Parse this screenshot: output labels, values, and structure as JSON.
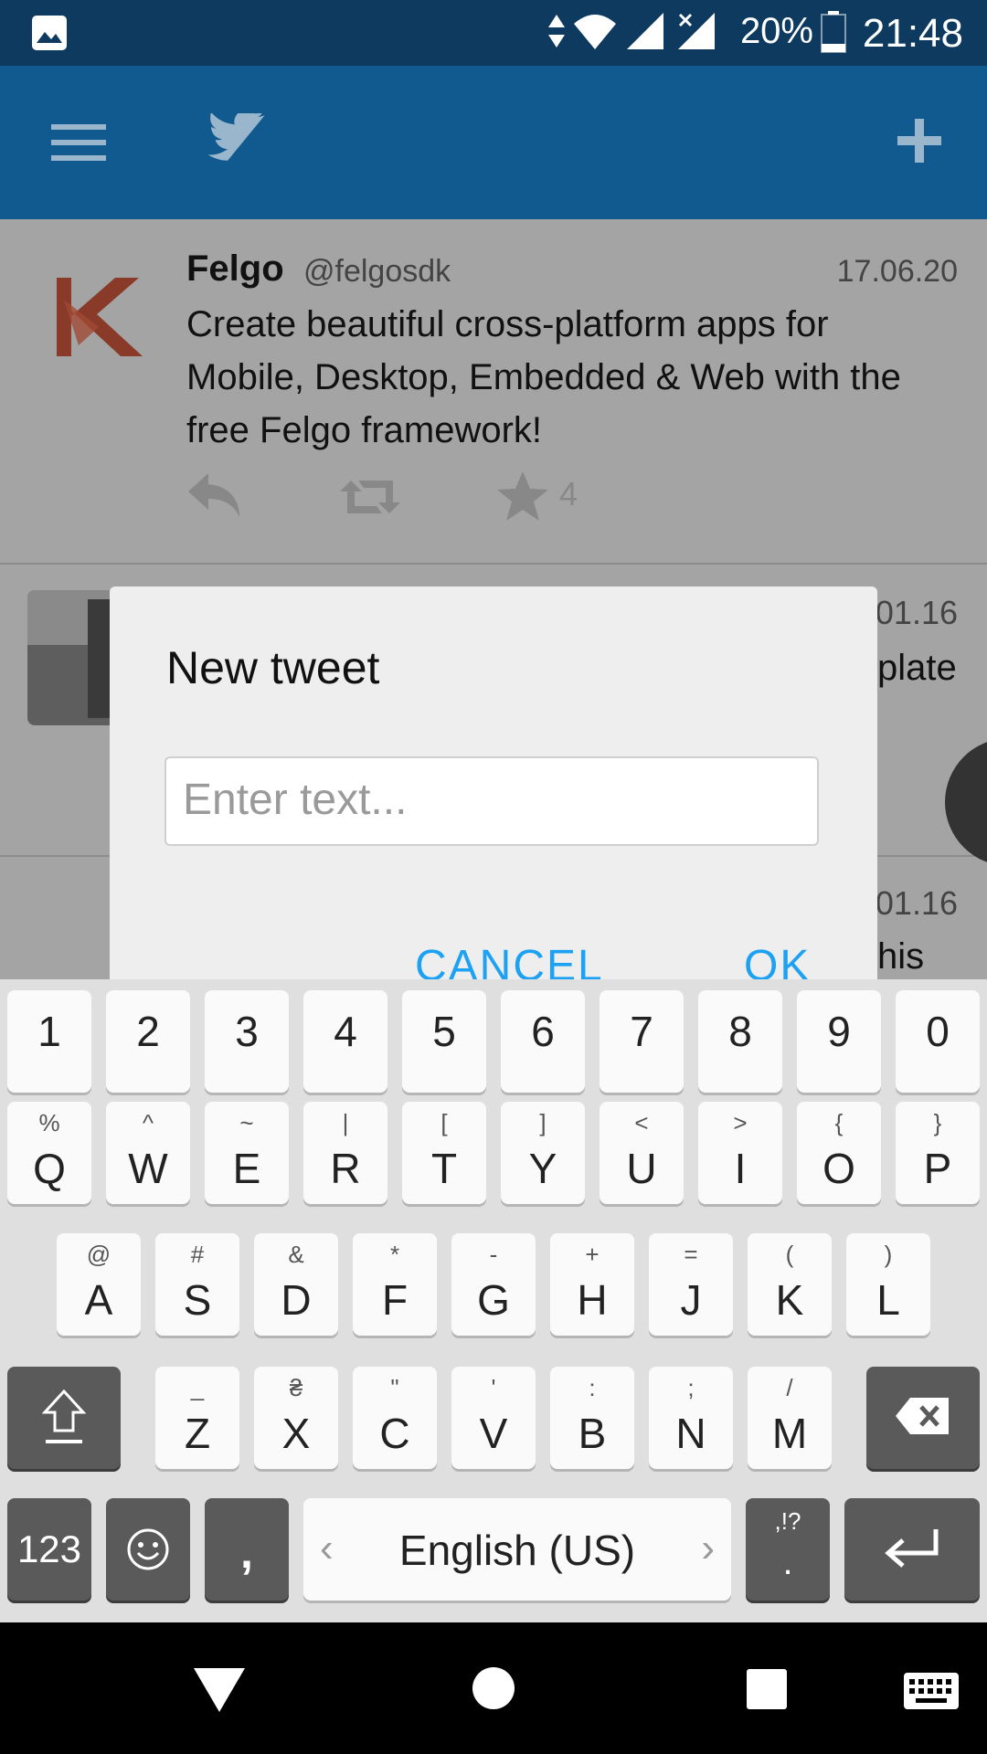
{
  "status_bar": {
    "battery": "20%",
    "time": "21:48"
  },
  "feed": {
    "tweets": [
      {
        "name": "Felgo",
        "handle": "@felgosdk",
        "date": "17.06.20",
        "text_lines": [
          "Create beautiful cross-platform apps for",
          "Mobile, Desktop, Embedded & Web with the",
          "free Felgo framework!"
        ],
        "like_count": "4"
      },
      {
        "date": "01.16",
        "text_fragment": "plate"
      },
      {
        "date": "01.16",
        "text_fragment": "his"
      }
    ]
  },
  "dialog": {
    "title": "New tweet",
    "input_placeholder": "Enter text...",
    "input_value": "",
    "cancel_label": "CANCEL",
    "ok_label": "OK"
  },
  "keyboard": {
    "number_row": [
      "1",
      "2",
      "3",
      "4",
      "5",
      "6",
      "7",
      "8",
      "9",
      "0"
    ],
    "row1": [
      {
        "main": "Q",
        "sub": "%"
      },
      {
        "main": "W",
        "sub": "^"
      },
      {
        "main": "E",
        "sub": "~"
      },
      {
        "main": "R",
        "sub": "|"
      },
      {
        "main": "T",
        "sub": "["
      },
      {
        "main": "Y",
        "sub": "]"
      },
      {
        "main": "U",
        "sub": "<"
      },
      {
        "main": "I",
        "sub": ">"
      },
      {
        "main": "O",
        "sub": "{"
      },
      {
        "main": "P",
        "sub": "}"
      }
    ],
    "row2": [
      {
        "main": "A",
        "sub": "@"
      },
      {
        "main": "S",
        "sub": "#"
      },
      {
        "main": "D",
        "sub": "&"
      },
      {
        "main": "F",
        "sub": "*"
      },
      {
        "main": "G",
        "sub": "-"
      },
      {
        "main": "H",
        "sub": "+"
      },
      {
        "main": "J",
        "sub": "="
      },
      {
        "main": "K",
        "sub": "("
      },
      {
        "main": "L",
        "sub": ")"
      }
    ],
    "row3": [
      {
        "main": "Z",
        "sub": "_"
      },
      {
        "main": "X",
        "sub": "₴"
      },
      {
        "main": "C",
        "sub": "\""
      },
      {
        "main": "V",
        "sub": "'"
      },
      {
        "main": "B",
        "sub": ":"
      },
      {
        "main": "N",
        "sub": ";"
      },
      {
        "main": "M",
        "sub": "/"
      }
    ],
    "symbols_label": "123",
    "comma_label": ",",
    "language_label": "English (US)",
    "punct_top": ",!?",
    "punct_main": "."
  }
}
